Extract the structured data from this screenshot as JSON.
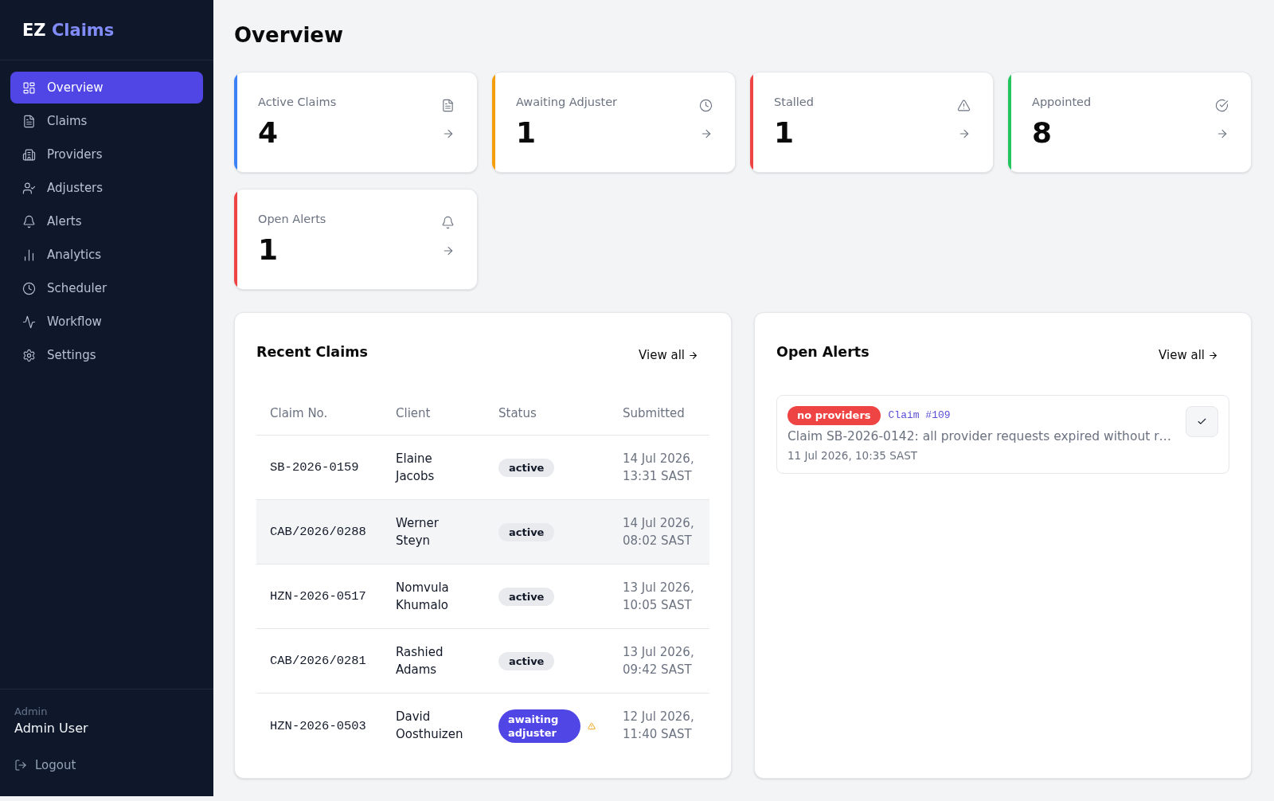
{
  "sidebar": {
    "brand": {
      "prefix": "EZ",
      "name": "Claims"
    },
    "nav": [
      {
        "label": "Overview",
        "selected": true
      },
      {
        "label": "Claims",
        "selected": false
      },
      {
        "label": "Providers",
        "selected": false
      },
      {
        "label": "Adjusters",
        "selected": false
      },
      {
        "label": "Alerts",
        "selected": false
      },
      {
        "label": "Analytics",
        "selected": false
      },
      {
        "label": "Scheduler",
        "selected": false
      },
      {
        "label": "Workflow",
        "selected": false
      },
      {
        "label": "Settings",
        "selected": false
      }
    ],
    "user": {
      "role": "Admin",
      "name": "Admin User"
    },
    "logout": "Logout"
  },
  "page": {
    "title": "Overview"
  },
  "stat_cards": [
    {
      "label": "Active Claims",
      "value": "4",
      "color": "#3b82f6"
    },
    {
      "label": "Awaiting Adjuster",
      "value": "1",
      "color": "#f59e0b"
    },
    {
      "label": "Stalled",
      "value": "1",
      "color": "#ef4444"
    },
    {
      "label": "Appointed",
      "value": "8",
      "color": "#22c55e"
    },
    {
      "label": "Open Alerts",
      "value": "1",
      "color": "#ef4444"
    }
  ],
  "recent_claims": {
    "title": "Recent Claims",
    "view_all": "View all",
    "columns": [
      "Claim No.",
      "Client",
      "Status",
      "Submitted"
    ],
    "rows": [
      {
        "claim_no": "SB-2026-0159",
        "client": "Elaine Jacobs",
        "status": {
          "label": "active",
          "kind": "active"
        },
        "warning": false,
        "submitted": "14 Jul 2026, 13:31 SAST",
        "highlighted": false
      },
      {
        "claim_no": "CAB/2026/0288",
        "client": "Werner Steyn",
        "status": {
          "label": "active",
          "kind": "active"
        },
        "warning": false,
        "submitted": "14 Jul 2026, 08:02 SAST",
        "highlighted": true
      },
      {
        "claim_no": "HZN-2026-0517",
        "client": "Nomvula Khumalo",
        "status": {
          "label": "active",
          "kind": "active"
        },
        "warning": false,
        "submitted": "13 Jul 2026, 10:05 SAST",
        "highlighted": false
      },
      {
        "claim_no": "CAB/2026/0281",
        "client": "Rashied Adams",
        "status": {
          "label": "active",
          "kind": "active"
        },
        "warning": false,
        "submitted": "13 Jul 2026, 09:42 SAST",
        "highlighted": false
      },
      {
        "claim_no": "HZN-2026-0503",
        "client": "David Oosthuizen",
        "status": {
          "label": "awaiting adjuster",
          "kind": "awaiting"
        },
        "warning": true,
        "submitted": "12 Jul 2026, 11:40 SAST",
        "highlighted": false
      }
    ]
  },
  "open_alerts": {
    "title": "Open Alerts",
    "view_all": "View all",
    "alerts": [
      {
        "tag": "no providers",
        "claim": "Claim #109",
        "message": "Claim SB-2026-0142: all provider requests expired without r…",
        "date": "11 Jul 2026, 10:35 SAST"
      }
    ]
  }
}
